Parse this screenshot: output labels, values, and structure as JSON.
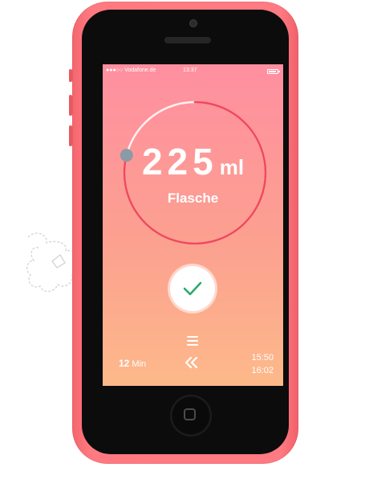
{
  "status_bar": {
    "carrier": "●●●○○ Vodafone.de",
    "time": "13:37",
    "battery_level": 0.9
  },
  "tracker": {
    "amount_value": "225",
    "amount_unit": "ml",
    "type": "Flasche",
    "progress_fraction": 0.79
  },
  "actions": {
    "confirm_icon": "checkmark-icon",
    "menu_icon": "menu-icon",
    "rewind_icon": "double-chevron-left-icon"
  },
  "footer": {
    "duration_value": "12",
    "duration_unit": "Min",
    "start_time": "15:50",
    "end_time": "16:02"
  },
  "colors": {
    "phone_body": "#ff7a82",
    "ring_progress": "#f0485c",
    "knob": "#8a9aa6",
    "check": "#28a86a"
  }
}
